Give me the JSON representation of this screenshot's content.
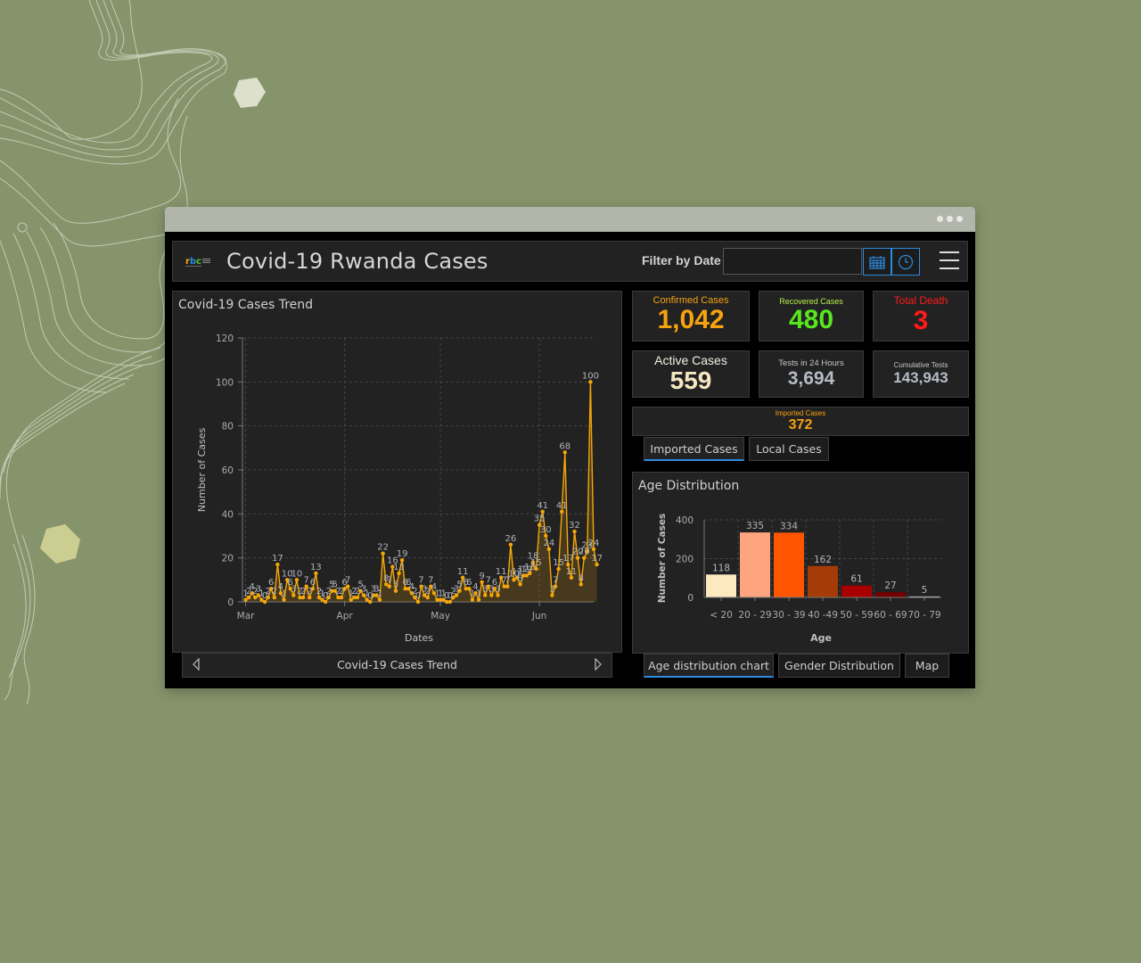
{
  "header": {
    "title": "Covid-19 Rwanda Cases",
    "logo_text": "rbc",
    "filter_label": "Filter by Date",
    "date_input_value": "",
    "calendar_icon": "calendar-icon",
    "clock_icon": "clock-icon",
    "menu_icon": "hamburger-menu-icon"
  },
  "colors": {
    "accent": "#2d8bde",
    "confirmed": "#f7a30f",
    "recovered": "#58e61e",
    "death": "#ff1a1a",
    "active": "#f6e7c1",
    "neutral_value": "#b5bcc6",
    "line": "#f5a70a",
    "background": "#86946c"
  },
  "stats": {
    "confirmed": {
      "label": "Confirmed Cases",
      "value": "1,042"
    },
    "recovered": {
      "label": "Recovered Cases",
      "value": "480"
    },
    "death": {
      "label": "Total Death",
      "value": "3"
    },
    "active": {
      "label": "Active Cases",
      "value": "559"
    },
    "tests_24h": {
      "label": "Tests in 24 Hours",
      "value": "3,694"
    },
    "cumulative_tests": {
      "label": "Cumulative Tests",
      "value": "143,943"
    },
    "imported": {
      "label": "Imported Cases",
      "value": "372"
    }
  },
  "cases_tabs": [
    {
      "label": "Imported Cases",
      "active": true
    },
    {
      "label": "Local Cases",
      "active": false
    }
  ],
  "bottom_tabs": [
    {
      "label": "Age distribution chart",
      "active": true
    },
    {
      "label": "Gender Distribution",
      "active": false
    },
    {
      "label": "Map",
      "active": false
    }
  ],
  "trend_nav": {
    "label": "Covid-19 Cases Trend",
    "prev_icon": "chevron-left-icon",
    "next_icon": "chevron-right-icon"
  },
  "chart_data": [
    {
      "type": "line",
      "title": "Covid-19 Cases Trend",
      "xlabel": "Dates",
      "ylabel": "Number of Cases",
      "ylim": [
        0,
        120
      ],
      "yticks": [
        0,
        20,
        40,
        60,
        80,
        100,
        120
      ],
      "month_ticks": [
        {
          "label": "Mar",
          "day": 1
        },
        {
          "label": "Apr",
          "day": 32
        },
        {
          "label": "May",
          "day": 62
        },
        {
          "label": "Jun",
          "day": 93
        }
      ],
      "x_range_days": [
        0,
        110
      ],
      "grid": true,
      "area_fill": true,
      "start_day": 1,
      "values": [
        1,
        2,
        4,
        2,
        3,
        1,
        0,
        2,
        6,
        2,
        17,
        4,
        1,
        10,
        6,
        3,
        10,
        2,
        2,
        7,
        2,
        6,
        13,
        2,
        1,
        0,
        2,
        5,
        5,
        2,
        2,
        6,
        7,
        1,
        2,
        2,
        5,
        3,
        1,
        0,
        3,
        3,
        1,
        22,
        8,
        7,
        16,
        5,
        13,
        19,
        6,
        6,
        4,
        2,
        0,
        7,
        3,
        2,
        7,
        4,
        1,
        1,
        1,
        0,
        0,
        2,
        3,
        5,
        11,
        6,
        6,
        1,
        4,
        1,
        9,
        3,
        7,
        3,
        6,
        3,
        11,
        7,
        7,
        26,
        10,
        11,
        8,
        12,
        12,
        13,
        18,
        15,
        35,
        41,
        30,
        24,
        3,
        7,
        15,
        41,
        68,
        17,
        11,
        32,
        20,
        8,
        20,
        23,
        100,
        24,
        17
      ]
    },
    {
      "type": "bar",
      "title": "Age Distribution",
      "xlabel": "Age",
      "ylabel": "Number of Cases",
      "categories": [
        "< 20",
        "20 - 29",
        "30 - 39",
        "40 -49",
        "50 - 59",
        "60 - 69",
        "70 - 79"
      ],
      "values": [
        118,
        335,
        334,
        162,
        61,
        27,
        5
      ],
      "bar_colors": [
        "#fde9c0",
        "#fea57f",
        "#ff5500",
        "#a53b06",
        "#a80000",
        "#730000",
        "#e0e0e0"
      ],
      "ylim": [
        0,
        400
      ],
      "yticks": [
        0,
        200,
        400
      ],
      "grid": true
    }
  ]
}
